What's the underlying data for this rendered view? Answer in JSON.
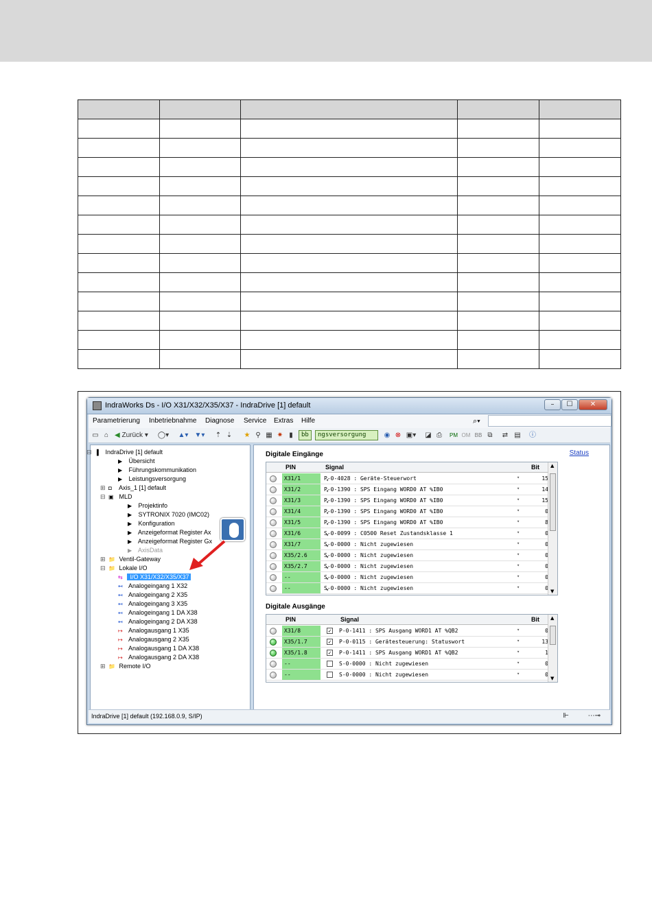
{
  "doc_table": {
    "rows": 13,
    "columns": 5
  },
  "window": {
    "title": "IndraWorks Ds - I/O X31/X32/X35/X37 - IndraDrive [1] default",
    "menu": [
      "Parametrierung",
      "Inbetriebnahme",
      "Diagnose",
      "Service",
      "Extras",
      "Hilfe"
    ],
    "toolbar": {
      "back_label": "Zurück",
      "bb_label": "bb",
      "status_field": "ngsversorgung"
    },
    "tree": [
      {
        "label": "IndraDrive [1] default",
        "level": 0,
        "icon": "drive-icon",
        "expander": "minus"
      },
      {
        "label": "Übersicht",
        "level": 2,
        "icon": "arrow-right-icon"
      },
      {
        "label": "Führungskommunikation",
        "level": 2,
        "icon": "arrow-right-icon"
      },
      {
        "label": "Leistungsversorgung",
        "level": 2,
        "icon": "arrow-right-icon"
      },
      {
        "label": "Axis_1 [1] default",
        "level": 1,
        "icon": "axis-icon",
        "expander": "plus"
      },
      {
        "label": "MLD",
        "level": 1,
        "icon": "mld-icon",
        "expander": "minus"
      },
      {
        "label": "Projektinfo",
        "level": 3,
        "icon": "arrow-right-icon"
      },
      {
        "label": "SYTRONIX 7020 (IMC02)",
        "level": 3,
        "icon": "arrow-right-icon"
      },
      {
        "label": "Konfiguration",
        "level": 3,
        "icon": "arrow-right-icon"
      },
      {
        "label": "Anzeigeformat Register Ax",
        "level": 3,
        "icon": "arrow-right-icon"
      },
      {
        "label": "Anzeigeformat Register Gx",
        "level": 3,
        "icon": "arrow-right-icon"
      },
      {
        "label": "AxisData",
        "level": 3,
        "icon": "arrow-right-gray-icon",
        "dim": true
      },
      {
        "label": "Ventil-Gateway",
        "level": 1,
        "icon": "folder-icon",
        "expander": "plus"
      },
      {
        "label": "Lokale I/O",
        "level": 1,
        "icon": "folder-icon",
        "expander": "minus"
      },
      {
        "label": "I/O X31/X32/X35/X37",
        "level": 2,
        "icon": "io-icon",
        "selected": true
      },
      {
        "label": "Analogeingang 1 X32",
        "level": 2,
        "icon": "analog-in-icon"
      },
      {
        "label": "Analogeingang 2 X35",
        "level": 2,
        "icon": "analog-in-icon"
      },
      {
        "label": "Analogeingang 3 X35",
        "level": 2,
        "icon": "analog-in-icon"
      },
      {
        "label": "Analogeingang 1 DA X38",
        "level": 2,
        "icon": "analog-in-icon"
      },
      {
        "label": "Analogeingang 2 DA X38",
        "level": 2,
        "icon": "analog-in-icon"
      },
      {
        "label": "Analogausgang 1 X35",
        "level": 2,
        "icon": "analog-out-icon"
      },
      {
        "label": "Analogausgang 2 X35",
        "level": 2,
        "icon": "analog-out-icon"
      },
      {
        "label": "Analogausgang 1 DA X38",
        "level": 2,
        "icon": "analog-out-icon"
      },
      {
        "label": "Analogausgang 2 DA X38",
        "level": 2,
        "icon": "analog-out-icon"
      },
      {
        "label": "Remote I/O",
        "level": 1,
        "icon": "folder-icon",
        "expander": "plus"
      }
    ],
    "inputs": {
      "title": "Digitale Eingänge",
      "status_link": "Status",
      "headers": {
        "pin": "PIN",
        "signal": "Signal",
        "bit": "Bit"
      },
      "rows": [
        {
          "led": false,
          "pin": "X31/1",
          "signal": "P-0-4028 :  Geräte-Steuerwort",
          "bit": "15"
        },
        {
          "led": false,
          "pin": "X31/2",
          "signal": "P-0-1390 :  SPS Eingang WORD0 AT %IB0",
          "bit": "14"
        },
        {
          "led": false,
          "pin": "X31/3",
          "signal": "P-0-1390 :  SPS Eingang WORD0 AT %IB0",
          "bit": "15"
        },
        {
          "led": false,
          "pin": "X31/4",
          "signal": "P-0-1390 :  SPS Eingang WORD0 AT %IB0",
          "bit": "0"
        },
        {
          "led": false,
          "pin": "X31/5",
          "signal": "P-0-1390 :  SPS Eingang WORD0 AT %IB0",
          "bit": "8"
        },
        {
          "led": false,
          "pin": "X31/6",
          "signal": "S-0-0099 :  C0500 Reset Zustandsklasse 1",
          "bit": "0"
        },
        {
          "led": false,
          "pin": "X31/7",
          "signal": "S-0-0000 :  Nicht zugewiesen",
          "bit": "0"
        },
        {
          "led": false,
          "pin": "X35/2.6",
          "signal": "S-0-0000 :  Nicht zugewiesen",
          "bit": "0"
        },
        {
          "led": false,
          "pin": "X35/2.7",
          "signal": "S-0-0000 :  Nicht zugewiesen",
          "bit": "0"
        },
        {
          "led": false,
          "pin": "--",
          "signal": "S-0-0000 :  Nicht zugewiesen",
          "bit": "0"
        },
        {
          "led": false,
          "pin": "--",
          "signal": "S-0-0000 :  Nicht zugewiesen",
          "bit": "0"
        }
      ]
    },
    "outputs": {
      "title": "Digitale Ausgänge",
      "headers": {
        "pin": "PIN",
        "signal": "Signal",
        "bit": "Bit"
      },
      "rows": [
        {
          "led": false,
          "pin": "X31/8",
          "checked": true,
          "signal": "P-0-1411 :  SPS Ausgang WORD1 AT %QB2",
          "bit": "0"
        },
        {
          "led": true,
          "pin": "X35/1.7",
          "checked": true,
          "signal": "P-0-0115 :  Gerätesteuerung: Statuswort",
          "bit": "13"
        },
        {
          "led": true,
          "pin": "X35/1.8",
          "checked": true,
          "signal": "P-0-1411 :  SPS Ausgang WORD1 AT %QB2",
          "bit": "1"
        },
        {
          "led": false,
          "pin": "--",
          "checked": false,
          "signal": "S-0-0000 :  Nicht zugewiesen",
          "bit": "0"
        },
        {
          "led": false,
          "pin": "--",
          "checked": false,
          "signal": "S-0-0000 :  Nicht zugewiesen",
          "bit": "0"
        }
      ]
    },
    "statusbar": "IndraDrive [1] default (192.168.0.9, S/IP)",
    "colors": {
      "pin_green": "#8ee08e",
      "selection": "#3399ff",
      "arrow_red": "#e02020"
    }
  }
}
